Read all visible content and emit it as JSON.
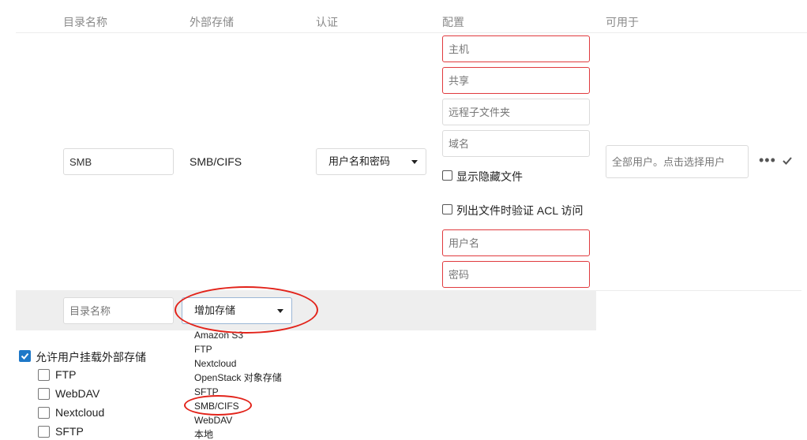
{
  "headers": {
    "folder_name": "目录名称",
    "external_storage": "外部存储",
    "authentication": "认证",
    "configuration": "配置",
    "available_for": "可用于"
  },
  "mount": {
    "folder_name_value": "SMB",
    "storage_type": "SMB/CIFS",
    "auth_method": "用户名和密码",
    "config": {
      "host_placeholder": "主机",
      "share_placeholder": "共享",
      "remote_subfolder_placeholder": "远程子文件夹",
      "domain_placeholder": "域名",
      "show_hidden_label": "显示隐藏文件",
      "check_acl_label": "列出文件时验证 ACL 访问",
      "username_placeholder": "用户名",
      "password_placeholder": "密码"
    },
    "applicable_placeholder": "全部用户。点击选择用户",
    "more_icon": "ellipsis-icon",
    "confirm_icon": "check-icon"
  },
  "add_row": {
    "folder_name_placeholder": "目录名称",
    "add_storage_label": "增加存储"
  },
  "dropdown_options": [
    "Amazon S3",
    "FTP",
    "Nextcloud",
    "OpenStack 对象存储",
    "SFTP",
    "SMB/CIFS",
    "WebDAV",
    "本地"
  ],
  "user_mounting": {
    "allow_label": "允许用户挂载外部存储",
    "backends": [
      "FTP",
      "WebDAV",
      "Nextcloud",
      "SFTP"
    ]
  },
  "colors": {
    "error_border": "#e03a3e",
    "annotation_ring": "#e2231a",
    "checkbox_accent": "#1e78c8"
  }
}
